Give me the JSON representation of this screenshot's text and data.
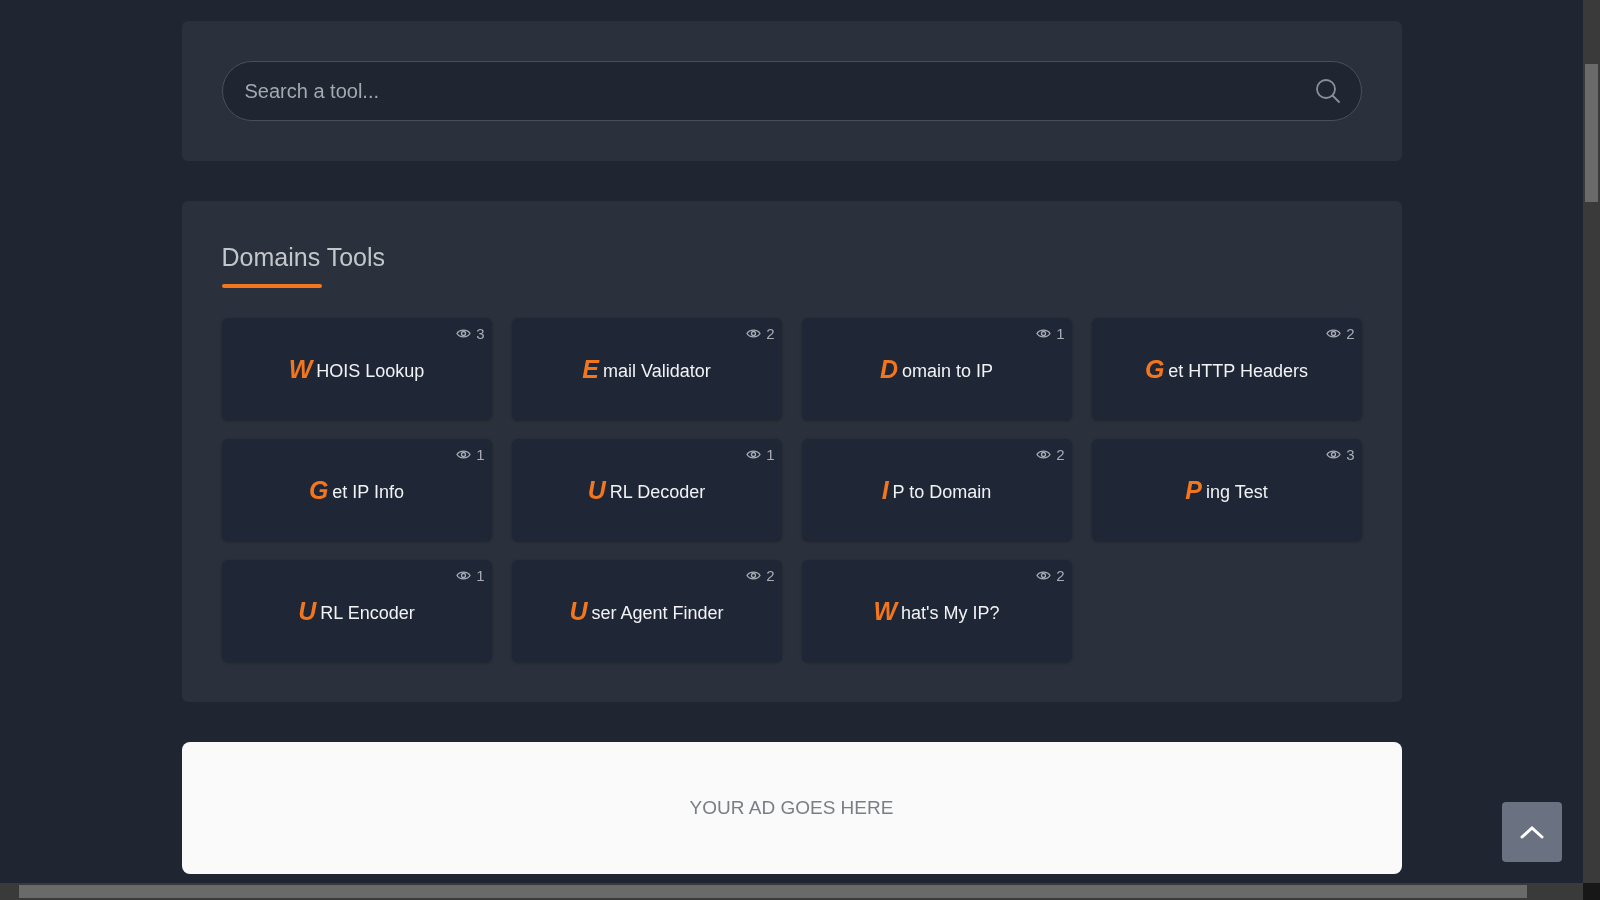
{
  "search": {
    "placeholder": "Search a tool..."
  },
  "section": {
    "title": "Domains Tools",
    "tools": [
      {
        "initial": "W",
        "label": "HOIS Lookup",
        "views": "3"
      },
      {
        "initial": "E",
        "label": "mail Validator",
        "views": "2"
      },
      {
        "initial": "D",
        "label": "omain to IP",
        "views": "1"
      },
      {
        "initial": "G",
        "label": "et HTTP Headers",
        "views": "2"
      },
      {
        "initial": "G",
        "label": "et IP Info",
        "views": "1"
      },
      {
        "initial": "U",
        "label": "RL Decoder",
        "views": "1"
      },
      {
        "initial": "I",
        "label": "P to Domain",
        "views": "2"
      },
      {
        "initial": "P",
        "label": "ing Test",
        "views": "3"
      },
      {
        "initial": "U",
        "label": "RL Encoder",
        "views": "1"
      },
      {
        "initial": "U",
        "label": "ser Agent Finder",
        "views": "2"
      },
      {
        "initial": "W",
        "label": "hat's My IP?",
        "views": "2"
      }
    ]
  },
  "ad": {
    "text": "YOUR AD GOES HERE"
  }
}
